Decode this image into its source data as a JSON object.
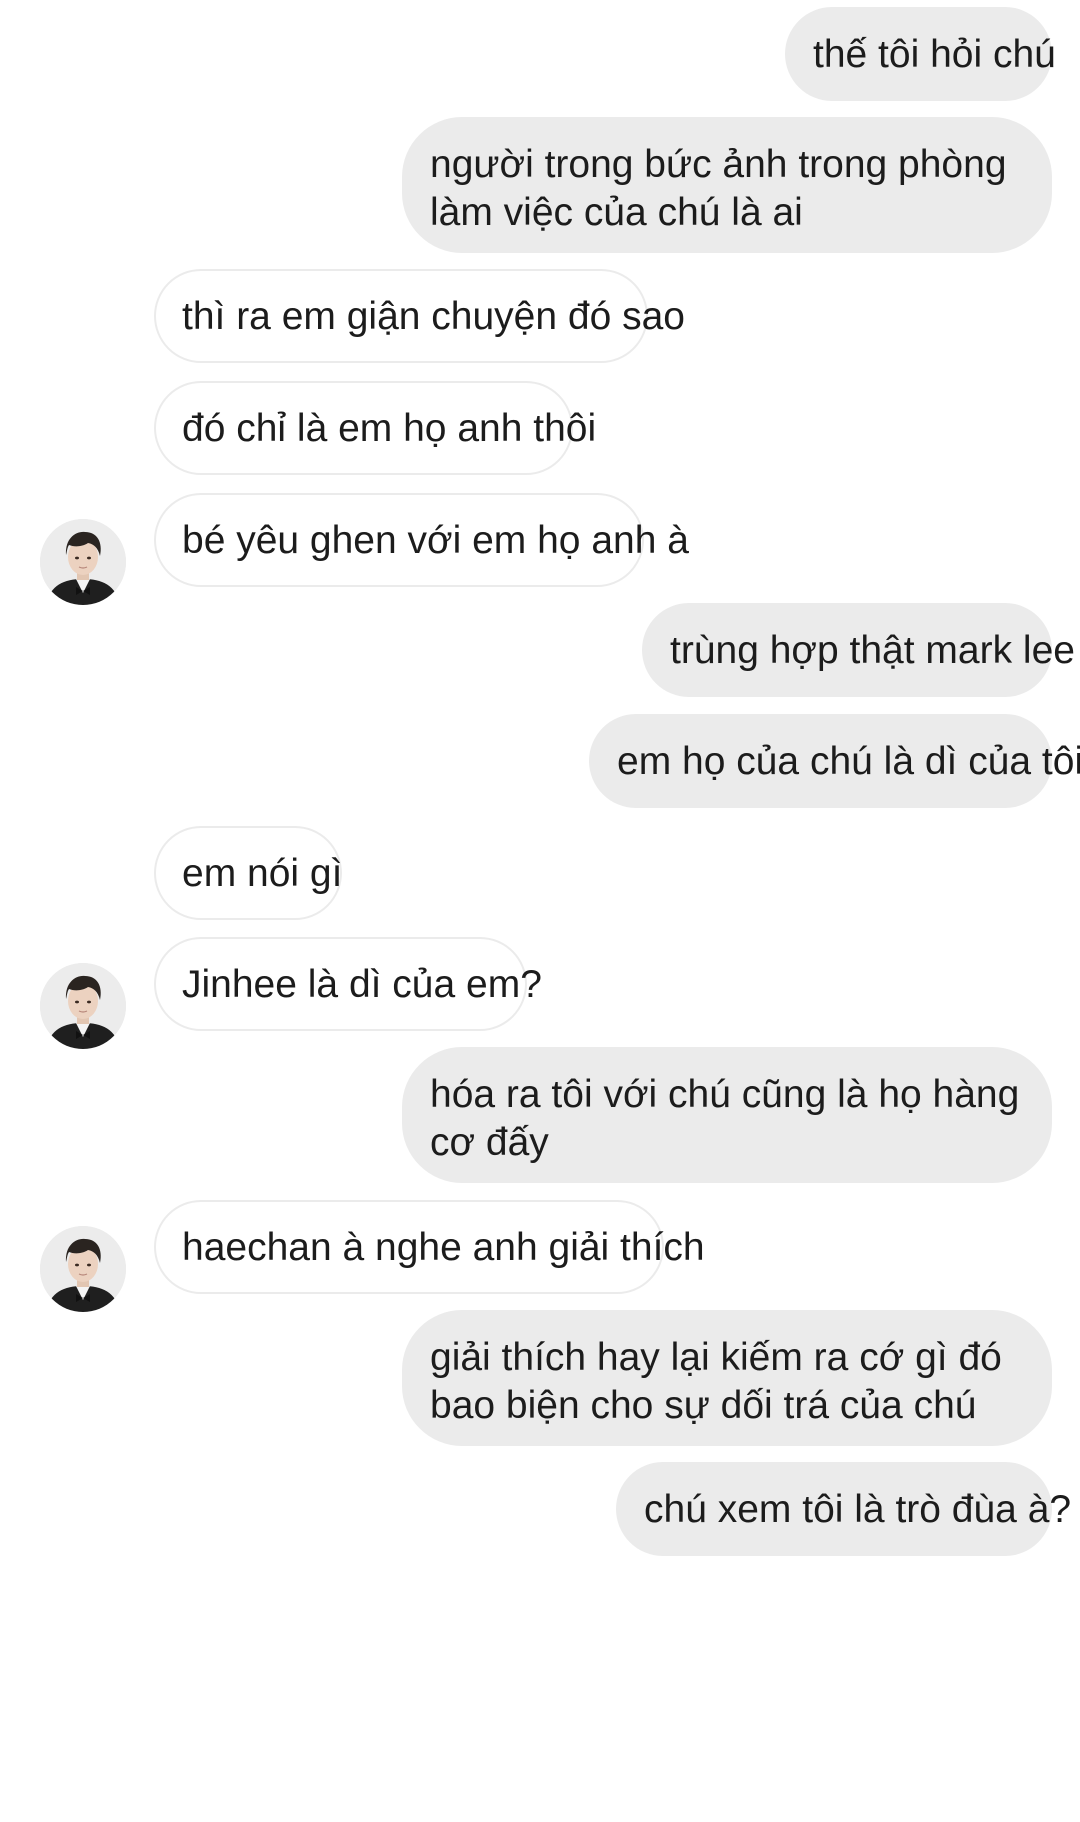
{
  "conversation": {
    "messages": [
      {
        "sender": "me",
        "text": "thế tôi hỏi chú"
      },
      {
        "sender": "me",
        "text": "người trong bức ảnh trong phòng làm việc của chú là ai"
      },
      {
        "sender": "other",
        "text": "thì ra em giận chuyện đó sao"
      },
      {
        "sender": "other",
        "text": "đó chỉ là em họ anh thôi"
      },
      {
        "sender": "other",
        "text": "bé yêu ghen với em họ anh à"
      },
      {
        "sender": "me",
        "text": "trùng hợp thật mark lee"
      },
      {
        "sender": "me",
        "text": "em họ của chú là dì của tôi"
      },
      {
        "sender": "other",
        "text": "em nói gì"
      },
      {
        "sender": "other",
        "text": "Jinhee là dì của em?"
      },
      {
        "sender": "me",
        "text": "hóa ra tôi với chú cũng là họ hàng cơ đấy"
      },
      {
        "sender": "other",
        "text": "haechan à nghe anh giải thích"
      },
      {
        "sender": "me",
        "text": "giải thích hay lại kiếm ra cớ gì đó bao biện cho sự dối trá của chú"
      },
      {
        "sender": "me",
        "text": "chú xem tôi là trò đùa à?"
      }
    ]
  },
  "colors": {
    "outgoing_bubble": "#ebebeb",
    "incoming_border": "#ebebeb",
    "text": "#1c1c1c"
  },
  "icons": {
    "avatar": "profile-photo-avatar"
  }
}
